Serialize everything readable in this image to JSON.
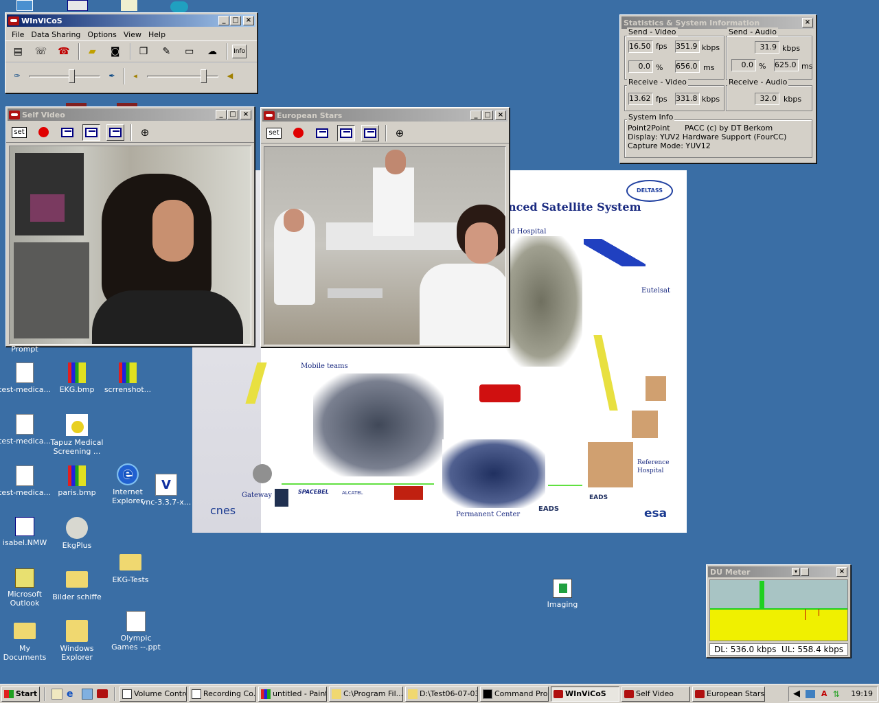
{
  "winvicos": {
    "title": "WInViCoS",
    "menu": [
      "File",
      "Data Sharing",
      "Options",
      "View",
      "Help"
    ],
    "info_label": "Info"
  },
  "self_video": {
    "title": "Self Video",
    "set_label": "set"
  },
  "european_stars": {
    "title": "European Stars",
    "set_label": "set"
  },
  "stats": {
    "title": "Statistics & System Information",
    "send_video": {
      "label": "Send - Video",
      "fps": "16.50",
      "fps_unit": "fps",
      "kbps": "351.9",
      "kbps_unit": "kbps",
      "loss": "0.0",
      "loss_unit": "%",
      "ms": "656.0",
      "ms_unit": "ms"
    },
    "send_audio": {
      "label": "Send - Audio",
      "kbps": "31.9",
      "kbps_unit": "kbps",
      "loss": "0.0",
      "loss_unit": "%",
      "ms": "625.0",
      "ms_unit": "ms"
    },
    "receive_video": {
      "label": "Receive - Video",
      "fps": "13.62",
      "fps_unit": "fps",
      "kbps": "331.8",
      "kbps_unit": "kbps"
    },
    "receive_audio": {
      "label": "Receive - Audio",
      "kbps": "32.0",
      "kbps_unit": "kbps"
    },
    "system_info": {
      "label": "System Info",
      "line1_key": "Point2Point",
      "line1_val": "PACC (c) by DT Berkom",
      "line2": "Display: YUV2 Hardware Support (FourCC)",
      "line3": "Capture Mode: YUV12"
    }
  },
  "poster": {
    "title": "nced Satellite System",
    "logo": "DELTASS",
    "field_hospital": "ld Hospital",
    "eutelsat": "Eutelsat",
    "mobile_teams": "Mobile teams",
    "gateway": "Gateway",
    "permanent_center": "Permanent Center",
    "reference_hospital": "Reference Hospital",
    "cnes": "cnes",
    "esa": "esa",
    "eads": "EADS",
    "spacebel": "SPACEBEL",
    "alcatel": "ALCATEL"
  },
  "du_meter": {
    "title": "DU Meter",
    "readout": "DL: 536.0 kbps  UL: 558.4 kbps"
  },
  "desktop_icons": [
    {
      "label": "Prompt"
    },
    {
      "label": "test-medica..."
    },
    {
      "label": "EKG.bmp"
    },
    {
      "label": "scrrenshot..."
    },
    {
      "label": "test-medica..."
    },
    {
      "label": "Tapuz Medical Screening ..."
    },
    {
      "label": "test-medica..."
    },
    {
      "label": "paris.bmp"
    },
    {
      "label": "Internet Explorer"
    },
    {
      "label": "vnc-3.3.7-x..."
    },
    {
      "label": "isabel.NMW"
    },
    {
      "label": "EkgPlus"
    },
    {
      "label": "Microsoft Outlook"
    },
    {
      "label": "Bilder schiffe"
    },
    {
      "label": "EKG-Tests"
    },
    {
      "label": "My Documents"
    },
    {
      "label": "Windows Explorer"
    },
    {
      "label": "Olympic Games --.ppt"
    },
    {
      "label": "Imaging"
    }
  ],
  "taskbar": {
    "start": "Start",
    "buttons": [
      "Volume Control",
      "Recording Co...",
      "untitled - Paint",
      "C:\\Program Fil...",
      "D:\\Test06-07-03",
      "Command Pro...",
      "WInViCoS",
      "Self Video",
      "European Stars"
    ],
    "clock": "19:19"
  }
}
